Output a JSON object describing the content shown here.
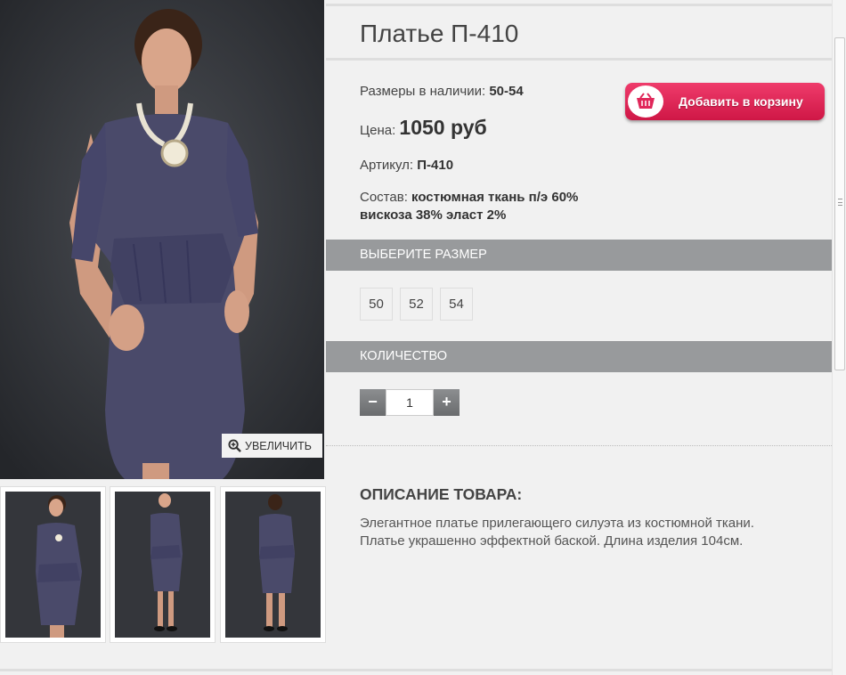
{
  "product": {
    "title": "Платье П-410",
    "sizes_label": "Размеры в наличии:",
    "sizes_value": "50-54",
    "price_label": "Цена:",
    "price_value": "1050 руб",
    "sku_label": "Артикул:",
    "sku_value": "П-410",
    "composition_label": "Состав:",
    "composition_line1": "костюмная ткань п/э 60%",
    "composition_line2": "вискоза 38% эласт 2%"
  },
  "cart_button": {
    "label": "Добавить в корзину",
    "icon": "basket-icon"
  },
  "gallery": {
    "zoom_label": "УВЕЛИЧИТЬ",
    "thumbnails": [
      "front-close",
      "front-full",
      "back-full"
    ]
  },
  "size_section": {
    "header": "ВЫБЕРИТЕ РАЗМЕР",
    "options": [
      "50",
      "52",
      "54"
    ]
  },
  "quantity_section": {
    "header": "КОЛИЧЕСТВО",
    "minus": "−",
    "plus": "+",
    "value": "1"
  },
  "description": {
    "title": "ОПИСАНИЕ ТОВАРА:",
    "line1": "Элегантное платье прилегающего силуэта из костюмной ткани.",
    "line2": "Платье украшенно эффектной баской. Длина изделия 104см."
  },
  "colors": {
    "cart_button": "#e0275a",
    "section_bar": "#989a9c",
    "photo_background": "#2e3034",
    "dress": "#4a4a6a"
  }
}
